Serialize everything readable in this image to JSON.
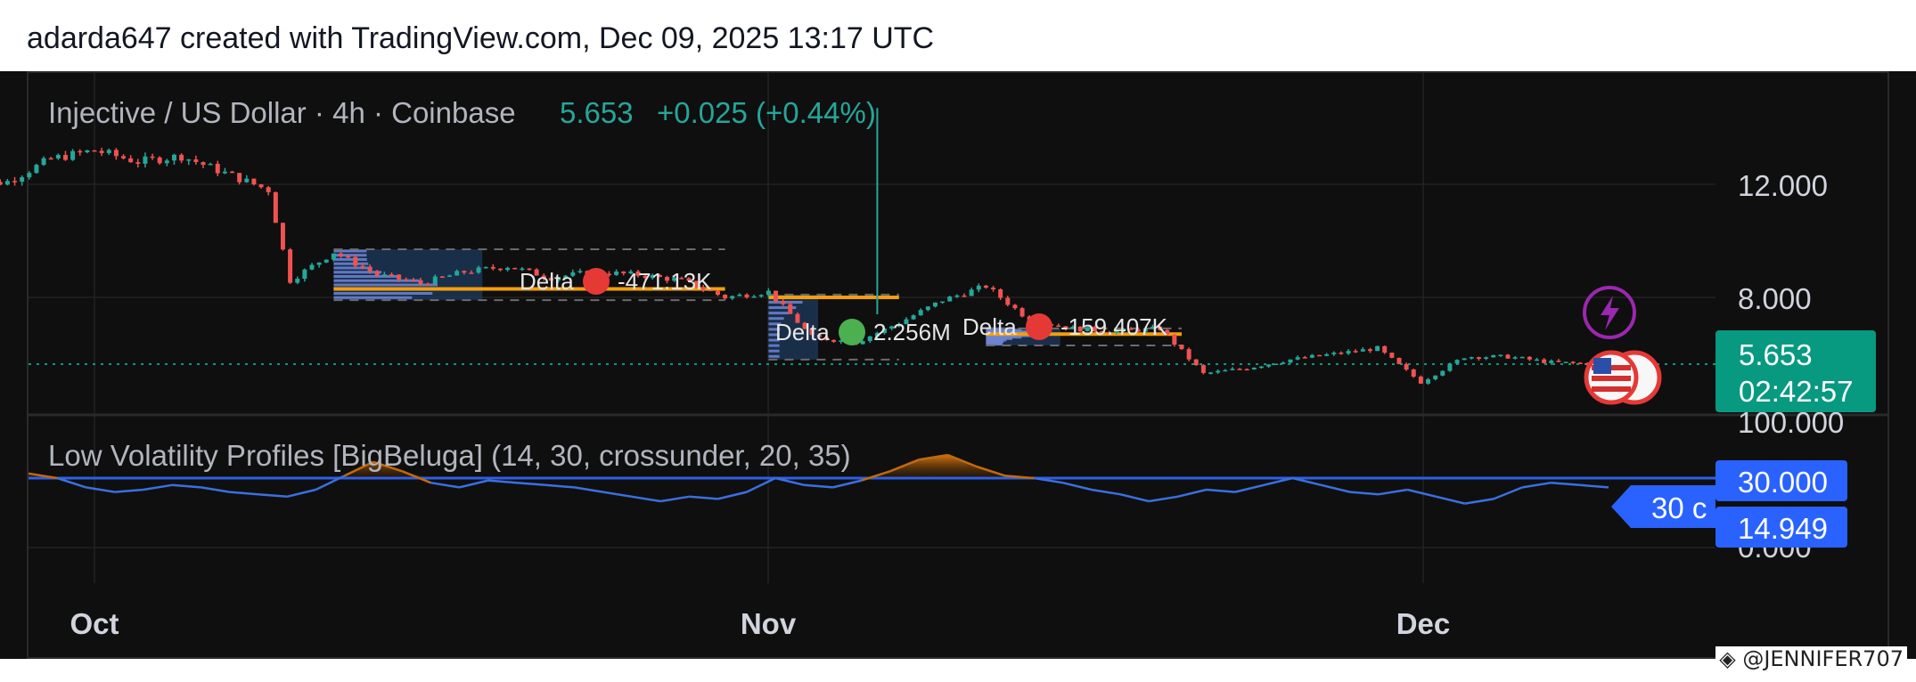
{
  "header": {
    "text": "adarda647 created with TradingView.com, Dec 09, 2025 13:17 UTC"
  },
  "symbol": {
    "title": "Injective / US Dollar · 4h · Coinbase",
    "price": "5.653",
    "change": "+0.025 (+0.44%)"
  },
  "price_scale": {
    "labels": [
      "12.000",
      "8.000",
      "100.000"
    ],
    "last_price": "5.653",
    "countdown": "02:42:57"
  },
  "indicator": {
    "title": "Low Volatility Profiles [BigBeluga] (14, 30, crossunder, 20, 35)",
    "scale_labels": [
      "30.000",
      "14.949",
      "0.000"
    ],
    "tag": "30 c"
  },
  "time_axis": {
    "labels": [
      "Oct",
      "Nov",
      "Dec"
    ]
  },
  "annotations": [
    {
      "prefix": "Delta",
      "value": "-471.13K",
      "dot": "red"
    },
    {
      "prefix": "Delta",
      "value": "2.256M",
      "dot": "green"
    },
    {
      "prefix": "Delta",
      "value": "-159.407K",
      "dot": "red"
    }
  ],
  "watermark": "@JENNIFER707",
  "colors": {
    "up": "#26a69a",
    "down": "#ef5350",
    "profile_line": "#f59e0b",
    "indicator_line": "#3b6fe0",
    "threshold": "#2f5fe3",
    "price_badge": "#089981",
    "indicator_badge": "#2962ff",
    "highlight": "#c26a10"
  },
  "chart_data": [
    {
      "type": "candlestick",
      "title": "Injective / US Dollar · 4h · Coinbase",
      "y_ticks": [
        8,
        12
      ],
      "last_price": 5.653,
      "x_ticks": [
        "Oct",
        "Nov",
        "Dec"
      ],
      "approx_close_path": [
        [
          "Sep 25",
          11.9
        ],
        [
          "Sep 27",
          12.1
        ],
        [
          "Sep 29",
          12.9
        ],
        [
          "Oct 01",
          13.2
        ],
        [
          "Oct 03",
          12.8
        ],
        [
          "Oct 05",
          13.0
        ],
        [
          "Oct 07",
          12.4
        ],
        [
          "Oct 09",
          11.8
        ],
        [
          "Oct 10",
          8.6
        ],
        [
          "Oct 12",
          9.6
        ],
        [
          "Oct 14",
          8.8
        ],
        [
          "Oct 16",
          8.5
        ],
        [
          "Oct 18",
          8.9
        ],
        [
          "Oct 20",
          9.1
        ],
        [
          "Oct 22",
          8.7
        ],
        [
          "Oct 24",
          8.9
        ],
        [
          "Oct 26",
          8.8
        ],
        [
          "Oct 28",
          8.6
        ],
        [
          "Oct 30",
          8.0
        ],
        [
          "Nov 01",
          8.2
        ],
        [
          "Nov 03",
          6.6
        ],
        [
          "Nov 05",
          6.4
        ],
        [
          "Nov 07",
          7.1
        ],
        [
          "Nov 09",
          7.9
        ],
        [
          "Nov 11",
          8.4
        ],
        [
          "Nov 13",
          7.2
        ],
        [
          "Nov 15",
          6.9
        ],
        [
          "Nov 17",
          6.8
        ],
        [
          "Nov 19",
          6.9
        ],
        [
          "Nov 21",
          5.3
        ],
        [
          "Nov 23",
          5.5
        ],
        [
          "Nov 25",
          5.8
        ],
        [
          "Nov 27",
          6.0
        ],
        [
          "Nov 29",
          6.2
        ],
        [
          "Dec 01",
          5.0
        ],
        [
          "Dec 03",
          5.9
        ],
        [
          "Dec 05",
          5.9
        ],
        [
          "Dec 07",
          5.7
        ],
        [
          "Dec 09",
          5.653
        ]
      ],
      "spike_high": 14.7,
      "volume_profiles": [
        {
          "poc": 8.3,
          "low": 7.9,
          "high": 9.7,
          "delta": "-471.13K"
        },
        {
          "poc": 8.0,
          "low": 5.8,
          "high": 8.1,
          "delta": "2.256M"
        },
        {
          "poc": 6.7,
          "low": 6.3,
          "high": 6.9,
          "delta": "-159.407K"
        }
      ]
    },
    {
      "type": "line",
      "title": "Low Volatility Profiles [BigBeluga] (14, 30, crossunder, 20, 35)",
      "y_ticks": [
        0,
        30
      ],
      "threshold": 30,
      "last_value": 14.949,
      "values": [
        32,
        30,
        26,
        24,
        25,
        27,
        26,
        24,
        23,
        22,
        25,
        31,
        37,
        33,
        28,
        26,
        29,
        28,
        27,
        26,
        24,
        22,
        20,
        22,
        21,
        24,
        30,
        27,
        26,
        29,
        33,
        38,
        40,
        35,
        31,
        30,
        28,
        25,
        23,
        20,
        22,
        25,
        24,
        27,
        30,
        27,
        24,
        23,
        25,
        22,
        19,
        21,
        26,
        28,
        27,
        26
      ]
    }
  ]
}
